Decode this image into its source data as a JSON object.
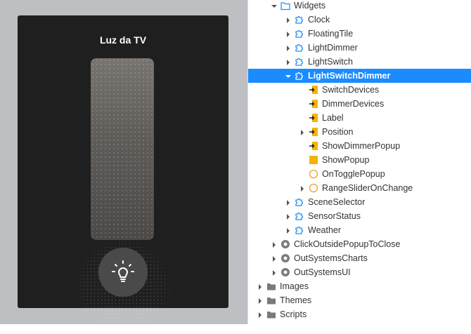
{
  "widget_preview": {
    "title": "Luz da TV",
    "dimmer_level": 0.0
  },
  "tree": {
    "items": [
      {
        "label": "Widgets",
        "depth": 1,
        "chevron": "down",
        "icon": "folder"
      },
      {
        "label": "Clock",
        "depth": 2,
        "chevron": "right",
        "icon": "block"
      },
      {
        "label": "FloatingTile",
        "depth": 2,
        "chevron": "right",
        "icon": "block"
      },
      {
        "label": "LightDimmer",
        "depth": 2,
        "chevron": "right",
        "icon": "block"
      },
      {
        "label": "LightSwitch",
        "depth": 2,
        "chevron": "right",
        "icon": "block"
      },
      {
        "label": "LightSwitchDimmer",
        "depth": 2,
        "chevron": "down",
        "icon": "block",
        "selected": true
      },
      {
        "label": "SwitchDevices",
        "depth": 3,
        "chevron": "none",
        "icon": "input-param"
      },
      {
        "label": "DimmerDevices",
        "depth": 3,
        "chevron": "none",
        "icon": "input-param"
      },
      {
        "label": "Label",
        "depth": 3,
        "chevron": "none",
        "icon": "input-param"
      },
      {
        "label": "Position",
        "depth": 3,
        "chevron": "right",
        "icon": "input-param"
      },
      {
        "label": "ShowDimmerPopup",
        "depth": 3,
        "chevron": "none",
        "icon": "input-param"
      },
      {
        "label": "ShowPopup",
        "depth": 3,
        "chevron": "none",
        "icon": "local-variable"
      },
      {
        "label": "OnTogglePopup",
        "depth": 3,
        "chevron": "none",
        "icon": "event"
      },
      {
        "label": "RangeSliderOnChange",
        "depth": 3,
        "chevron": "right",
        "icon": "event"
      },
      {
        "label": "SceneSelector",
        "depth": 2,
        "chevron": "right",
        "icon": "block"
      },
      {
        "label": "SensorStatus",
        "depth": 2,
        "chevron": "right",
        "icon": "block"
      },
      {
        "label": "Weather",
        "depth": 2,
        "chevron": "right",
        "icon": "block"
      },
      {
        "label": "ClickOutsidePopupToClose",
        "depth": 1,
        "chevron": "right",
        "icon": "module"
      },
      {
        "label": "OutSystemsCharts",
        "depth": 1,
        "chevron": "right",
        "icon": "module"
      },
      {
        "label": "OutSystemsUI",
        "depth": 1,
        "chevron": "right",
        "icon": "module"
      },
      {
        "label": "Images",
        "depth": 0,
        "chevron": "right",
        "icon": "folder-closed"
      },
      {
        "label": "Themes",
        "depth": 0,
        "chevron": "right",
        "icon": "folder-closed"
      },
      {
        "label": "Scripts",
        "depth": 0,
        "chevron": "right",
        "icon": "folder-closed"
      }
    ]
  },
  "colors": {
    "selection": "#1a8cff",
    "block_icon": "#1a8cff",
    "param_icon": "#f5b400",
    "event_icon": "#f0a030",
    "module_icon": "#7a7a7a",
    "folder_icon": "#7a7a7a"
  }
}
